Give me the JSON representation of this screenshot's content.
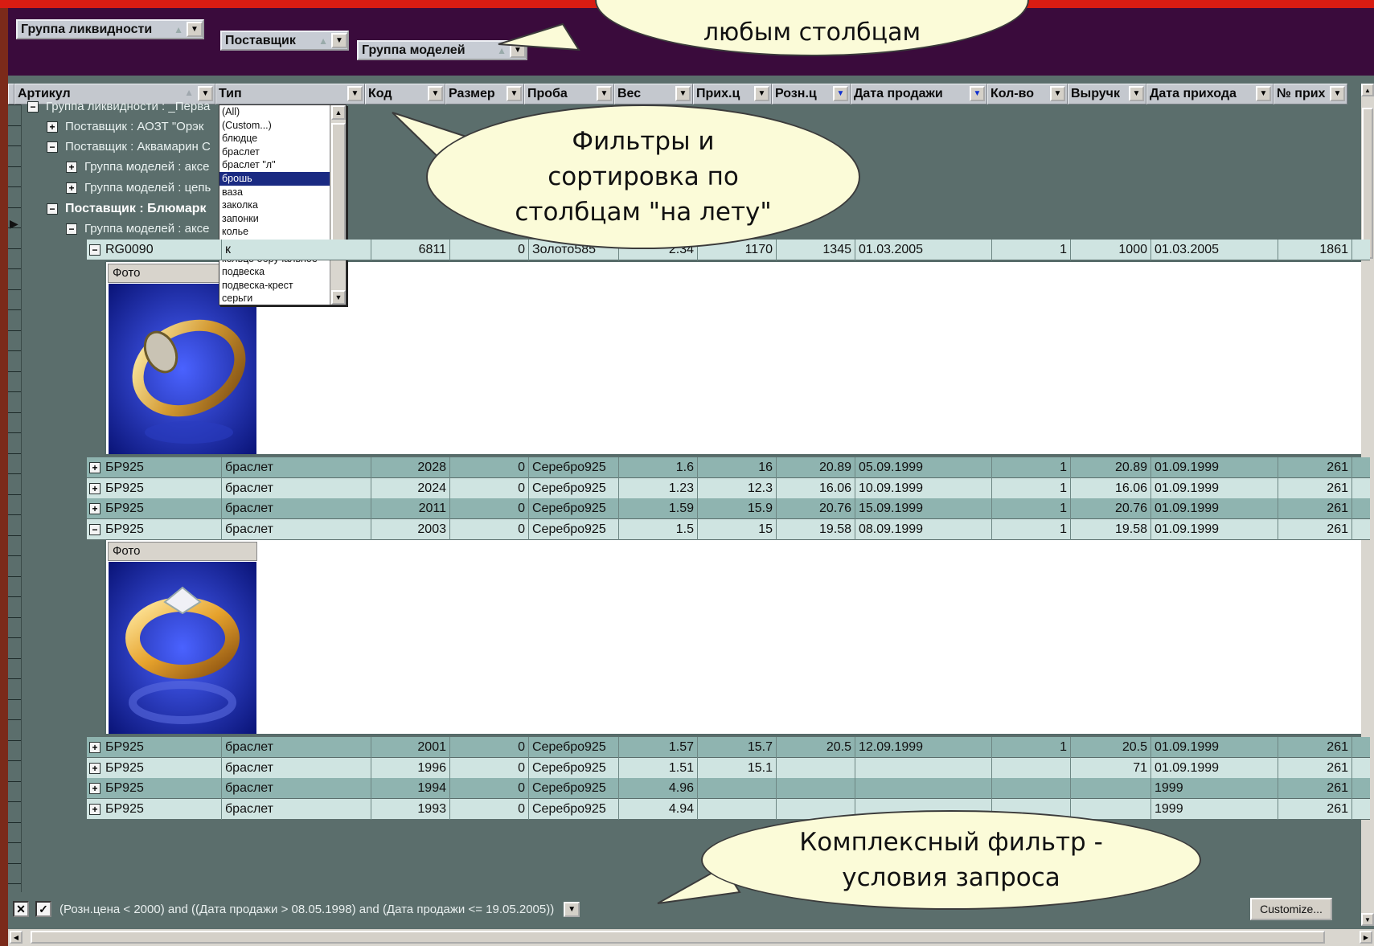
{
  "group_panel": {
    "chips": [
      "Группа ликвидности",
      "Поставщик",
      "Группа моделей"
    ]
  },
  "columns": [
    "Артикул",
    "Тип",
    "Код",
    "Размер",
    "Проба",
    "Вес",
    "Прих.ц",
    "Розн.ц",
    "Дата продажи",
    "Кол-во",
    "Выручк",
    "Дата прихода",
    "№ прих"
  ],
  "groups": [
    {
      "text": "Группа ликвидности : _Перва",
      "level": 0,
      "expanded": true,
      "bold": false
    },
    {
      "text": "Поставщик : АОЗТ \"Орэк",
      "level": 1,
      "expanded": false,
      "bold": false
    },
    {
      "text": "Поставщик : Аквамарин С",
      "level": 1,
      "expanded": true,
      "bold": false
    },
    {
      "text": "Группа моделей : аксе",
      "level": 2,
      "expanded": false,
      "bold": false
    },
    {
      "text": "Группа моделей : цепь",
      "level": 2,
      "expanded": false,
      "bold": false
    },
    {
      "text": "Поставщик : Блюмарк",
      "level": 1,
      "expanded": true,
      "bold": true
    },
    {
      "text": "Группа моделей : аксе",
      "level": 2,
      "expanded": true,
      "bold": false
    }
  ],
  "first_row": {
    "cells": [
      "RG0090",
      "к",
      "6811",
      "0",
      "Золото585",
      "2.34",
      "1170",
      "1345",
      "01.03.2005",
      "1",
      "1000",
      "01.03.2005",
      "1861"
    ]
  },
  "photo_label": "Фото",
  "rows_block1": [
    [
      "БР925",
      "браслет",
      "2028",
      "0",
      "Серебро925",
      "1.6",
      "16",
      "20.89",
      "05.09.1999",
      "1",
      "20.89",
      "01.09.1999",
      "261"
    ],
    [
      "БР925",
      "браслет",
      "2024",
      "0",
      "Серебро925",
      "1.23",
      "12.3",
      "16.06",
      "10.09.1999",
      "1",
      "16.06",
      "01.09.1999",
      "261"
    ],
    [
      "БР925",
      "браслет",
      "2011",
      "0",
      "Серебро925",
      "1.59",
      "15.9",
      "20.76",
      "15.09.1999",
      "1",
      "20.76",
      "01.09.1999",
      "261"
    ],
    [
      "БР925",
      "браслет",
      "2003",
      "0",
      "Серебро925",
      "1.5",
      "15",
      "19.58",
      "08.09.1999",
      "1",
      "19.58",
      "01.09.1999",
      "261"
    ]
  ],
  "rows_block2": [
    [
      "БР925",
      "браслет",
      "2001",
      "0",
      "Серебро925",
      "1.57",
      "15.7",
      "20.5",
      "12.09.1999",
      "1",
      "20.5",
      "01.09.1999",
      "261"
    ],
    [
      "БР925",
      "браслет",
      "1996",
      "0",
      "Серебро925",
      "1.51",
      "15.1",
      "",
      "",
      "",
      "71",
      "01.09.1999",
      "261"
    ],
    [
      "БР925",
      "браслет",
      "1994",
      "0",
      "Серебро925",
      "4.96",
      "",
      "",
      "",
      "",
      "",
      "1999",
      "261"
    ],
    [
      "БР925",
      "браслет",
      "1993",
      "0",
      "Серебро925",
      "4.94",
      "",
      "",
      "",
      "",
      "",
      "1999",
      "261"
    ]
  ],
  "dropdown": {
    "items": [
      "(All)",
      "(Custom...)",
      "блюдце",
      "браслет",
      "браслет \"л\"",
      "брошь",
      "ваза",
      "заколка",
      "запонки",
      "колье",
      "кольцо",
      "кольцо обручальное",
      "подвеска",
      "подвеска-крест",
      "серьги"
    ],
    "selected": "брошь"
  },
  "callouts": {
    "top": "любым столбцам",
    "filters": "Фильтры и сортировка по столбцам \"на лету\"",
    "complex": "Комплексный фильтр - условия запроса"
  },
  "filter_bar": {
    "text": "(Розн.цена < 2000) and ((Дата продажи > 08.05.1998) and (Дата продажи <= 19.05.2005))",
    "customize_label": "Customize..."
  },
  "colors": {
    "grid_dark": "#8fb4b0",
    "grid_light": "#cfe4e1",
    "group_bg": "#5b6e6c",
    "group_panel": "#3a0b3c",
    "callout": "#fbfbd8",
    "selection": "#1a2a82"
  }
}
